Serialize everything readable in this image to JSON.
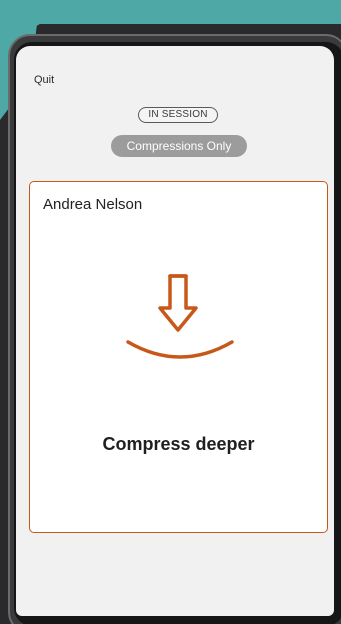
{
  "header": {
    "quit_label": "Quit",
    "status_badge": "IN SESSION",
    "mode_label": "Compressions Only"
  },
  "card": {
    "patient_name": "Andrea Nelson",
    "icon": "compress-down-arrow-icon",
    "message": "Compress deeper",
    "accent_color": "#c8581a"
  },
  "colors": {
    "background_accent": "#4ea8a5",
    "screen_background": "#f1f1f1",
    "mode_pill_background": "#9c9c9c"
  }
}
